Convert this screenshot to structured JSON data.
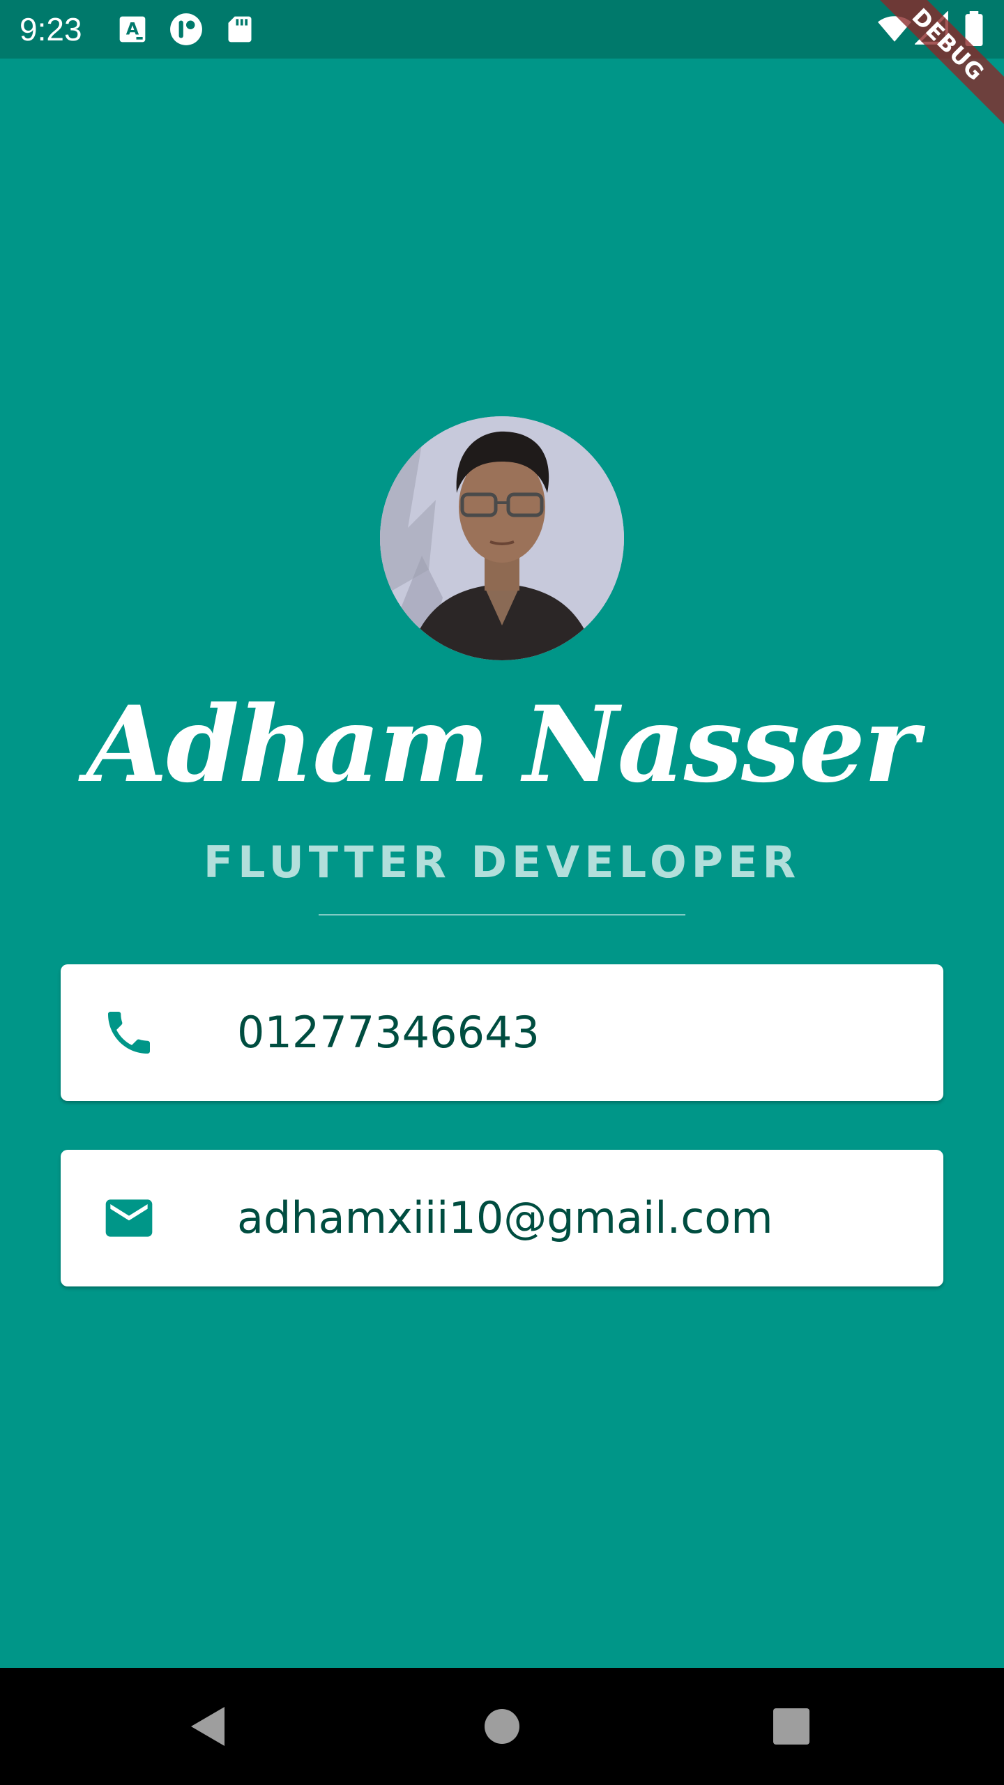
{
  "status_bar": {
    "time": "9:23",
    "icons": [
      "a-keyboard-icon",
      "app-notification-icon",
      "sd-card-icon",
      "wifi-icon",
      "cell-signal-icon",
      "battery-icon"
    ]
  },
  "debug_banner": {
    "label": "DEBUG"
  },
  "profile": {
    "name": "Adham Nasser",
    "title": "FLUTTER DEVELOPER",
    "avatar_alt": "profile-photo"
  },
  "contacts": {
    "phone": {
      "icon": "phone-icon",
      "value": "01277346643"
    },
    "email": {
      "icon": "mail-icon",
      "value": "adhamxiii10@gmail.com"
    }
  },
  "nav_bar": {
    "buttons": [
      "back-icon",
      "home-icon",
      "recents-icon"
    ]
  },
  "colors": {
    "background": "#009688",
    "status_bar": "#00796B",
    "title_text": "#B2DFDB",
    "card_text": "#004D40",
    "icon": "#009688",
    "card": "#ffffff"
  }
}
